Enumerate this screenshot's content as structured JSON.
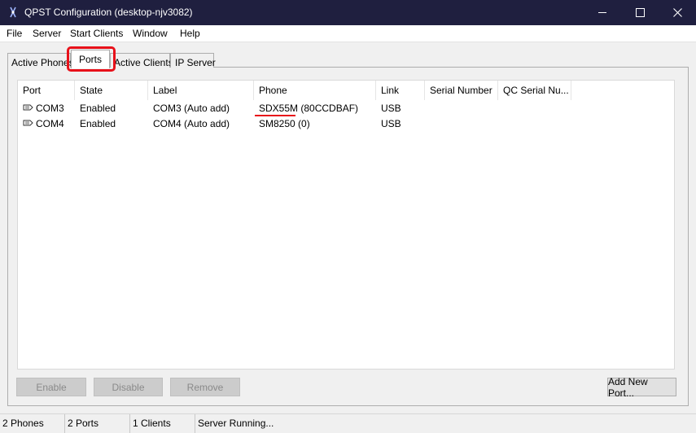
{
  "window": {
    "title": "QPST Configuration (desktop-njv3082)",
    "minimize_glyph": "—",
    "maximize_glyph": "□",
    "close_glyph": "✕"
  },
  "menu": [
    "File",
    "Server",
    "Start Clients",
    "Window",
    "Help"
  ],
  "tabs": [
    {
      "label": "Active Phones"
    },
    {
      "label": "Ports",
      "selected": true
    },
    {
      "label": "Active Clients"
    },
    {
      "label": "IP Server"
    }
  ],
  "ports_table": {
    "columns": [
      "Port",
      "State",
      "Label",
      "Phone",
      "Link",
      "Serial Number",
      "QC Serial Nu..."
    ],
    "rows": [
      {
        "port": "COM3",
        "state": "Enabled",
        "label": "COM3 (Auto add)",
        "phone": "SDX55M (80CCDBAF)",
        "link": "USB",
        "serial": "",
        "qc_serial": ""
      },
      {
        "port": "COM4",
        "state": "Enabled",
        "label": "COM4 (Auto add)",
        "phone": "SM8250 (0)",
        "link": "USB",
        "serial": "",
        "qc_serial": ""
      }
    ]
  },
  "buttons": {
    "enable": "Enable",
    "disable": "Disable",
    "remove": "Remove",
    "add_new_port": "Add New Port..."
  },
  "status": {
    "phones": "2 Phones",
    "ports": "2 Ports",
    "clients": "1 Clients",
    "server": "Server Running..."
  },
  "colors": {
    "titlebar": "#1f1f3f",
    "annotation": "#e8111a"
  }
}
